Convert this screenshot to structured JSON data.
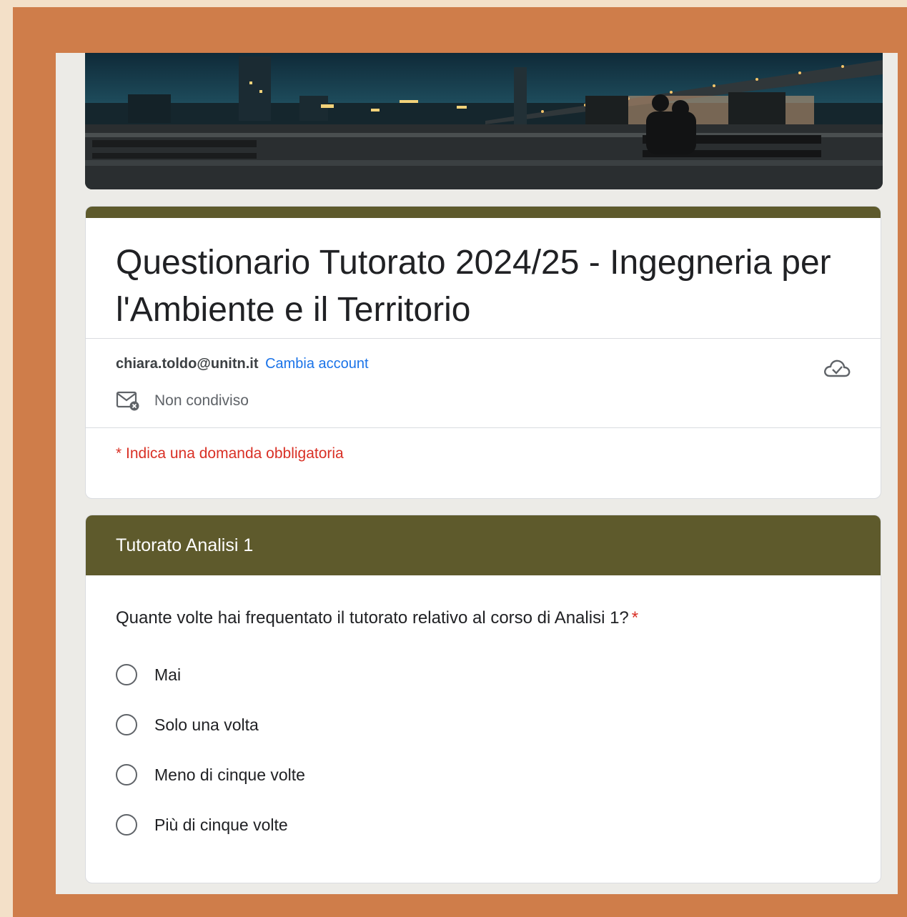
{
  "form": {
    "title": "Questionario Tutorato 2024/25 - Ingegneria per l'Ambiente e il Territorio",
    "account_email": "chiara.toldo@unitn.it",
    "switch_account_label": "Cambia account",
    "share_status": "Non condiviso",
    "required_note": "* Indica una domanda obbligatoria"
  },
  "section": {
    "title": "Tutorato Analisi 1",
    "question": {
      "text": "Quante volte hai frequentato il tutorato relativo al corso di Analisi 1?",
      "required_marker": "*",
      "options": [
        "Mai",
        "Solo una volta",
        "Meno di cinque volte",
        "Più di cinque volte"
      ]
    }
  },
  "icons": {
    "share_status_icon": "mail-off-icon",
    "save_status_icon": "cloud-check-icon"
  },
  "colors": {
    "theme": "#5e5a2c",
    "link": "#1a73e8",
    "required": "#d93025",
    "frame": "#cf7d4a",
    "background": "#f3e0c8"
  }
}
